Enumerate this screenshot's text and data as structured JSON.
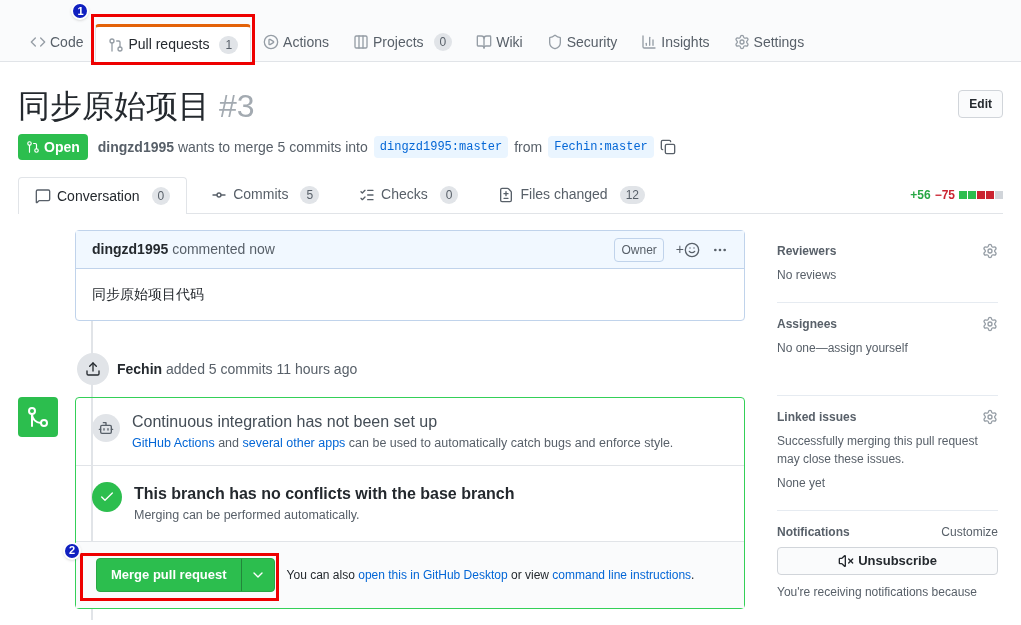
{
  "repo_tabs": [
    {
      "label": "Code",
      "selected": false
    },
    {
      "label": "Pull requests",
      "count": "1",
      "selected": true
    },
    {
      "label": "Actions",
      "selected": false
    },
    {
      "label": "Projects",
      "count": "0",
      "selected": false
    },
    {
      "label": "Wiki",
      "selected": false
    },
    {
      "label": "Security",
      "selected": false
    },
    {
      "label": "Insights",
      "selected": false
    },
    {
      "label": "Settings",
      "selected": false
    }
  ],
  "pr": {
    "title": "同步原始项目",
    "number": "#3",
    "edit_button": "Edit",
    "status": "Open",
    "author": "dingzd1995",
    "summary": "wants to merge 5 commits into",
    "base": "dingzd1995:master",
    "from_word": "from",
    "head": "Fechin:master"
  },
  "pr_tabs": [
    {
      "label": "Conversation",
      "count": "0",
      "selected": true
    },
    {
      "label": "Commits",
      "count": "5",
      "selected": false
    },
    {
      "label": "Checks",
      "count": "0",
      "selected": false
    },
    {
      "label": "Files changed",
      "count": "12",
      "selected": false
    }
  ],
  "diffstat": {
    "added": "+56",
    "removed": "−75",
    "blocks": [
      {
        "color": "#2cbe4e"
      },
      {
        "color": "#2cbe4e"
      },
      {
        "color": "#cb2431"
      },
      {
        "color": "#cb2431"
      },
      {
        "color": "#d1d5da"
      }
    ]
  },
  "comment": {
    "author": "dingzd1995",
    "action": "commented now",
    "role": "Owner",
    "reaction": "+",
    "body": "同步原始项目代码"
  },
  "event": {
    "actor": "Fechin",
    "text": "added 5 commits 11 hours ago"
  },
  "merge_box": {
    "ci": {
      "title": "Continuous integration has not been set up",
      "link1": "GitHub Actions",
      "and": "and",
      "link2": "several other apps",
      "rest": "can be used to automatically catch bugs and enforce style."
    },
    "conflicts": {
      "title": "This branch has no conflicts with the base branch",
      "subtitle": "Merging can be performed automatically."
    },
    "merge_button": "Merge pull request",
    "also_text": "You can also",
    "desktop_link": "open this in GitHub Desktop",
    "or_view": "or view",
    "cli_link": "command line instructions",
    "period": "."
  },
  "sidebar": [
    {
      "kind": "section",
      "title": "Reviewers",
      "lines": [
        "No reviews"
      ]
    },
    {
      "kind": "section",
      "title": "Assignees",
      "lines": [
        "No one—assign yourself"
      ]
    },
    {
      "kind": "section",
      "title": "Linked issues",
      "lines": [
        "Successfully merging this pull request may close these issues.",
        "None yet"
      ]
    },
    {
      "kind": "notifications",
      "title": "Notifications",
      "action": "Customize",
      "button": "Unsubscribe",
      "lines": [
        "You're receiving notifications because"
      ]
    }
  ],
  "annotations": [
    {
      "label": "1"
    },
    {
      "label": "2"
    }
  ]
}
